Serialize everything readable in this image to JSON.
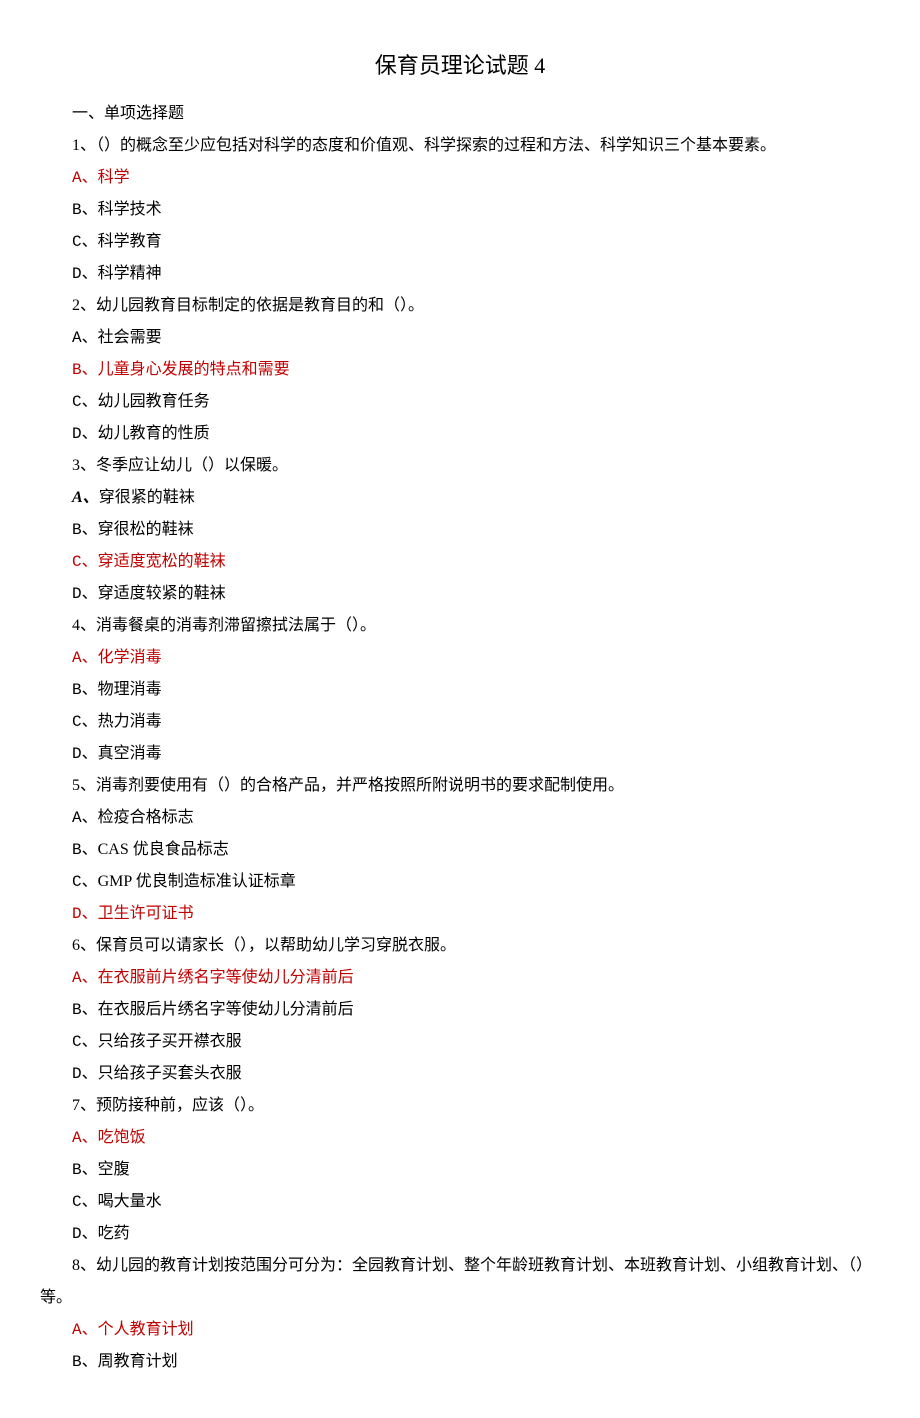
{
  "title": "保育员理论试题 4",
  "section_header": "一、单项选择题",
  "questions": [
    {
      "stem": "1、（）的概念至少应包括对科学的态度和价值观、科学探索的过程和方法、科学知识三个基本要素。",
      "options": [
        {
          "letter": "A、",
          "text": "科学",
          "correct": true
        },
        {
          "letter": "B、",
          "text": "科学技术",
          "correct": false
        },
        {
          "letter": "C、",
          "text": "科学教育",
          "correct": false
        },
        {
          "letter": "D、",
          "text": "科学精神",
          "correct": false
        }
      ]
    },
    {
      "stem": "2、幼儿园教育目标制定的依据是教育目的和（）。",
      "options": [
        {
          "letter": "A、",
          "text": "社会需要",
          "correct": false
        },
        {
          "letter": "B、",
          "text": "儿童身心发展的特点和需要",
          "correct": true
        },
        {
          "letter": "C、",
          "text": "幼儿园教育任务",
          "correct": false
        },
        {
          "letter": "D、",
          "text": "幼儿教育的性质",
          "correct": false
        }
      ]
    },
    {
      "stem": "3、冬季应让幼儿（）以保暖。",
      "options": [
        {
          "letter": "A、",
          "text": "穿很紧的鞋袜",
          "correct": false,
          "italicA": true
        },
        {
          "letter": "B、",
          "text": "穿很松的鞋袜",
          "correct": false
        },
        {
          "letter": "C、",
          "text": "穿适度宽松的鞋袜",
          "correct": true
        },
        {
          "letter": "D、",
          "text": "穿适度较紧的鞋袜",
          "correct": false
        }
      ]
    },
    {
      "stem": "4、消毒餐桌的消毒剂滞留擦拭法属于（）。",
      "options": [
        {
          "letter": "A、",
          "text": "化学消毒",
          "correct": true
        },
        {
          "letter": "B、",
          "text": "物理消毒",
          "correct": false
        },
        {
          "letter": "C、",
          "text": "热力消毒",
          "correct": false
        },
        {
          "letter": "D、",
          "text": "真空消毒",
          "correct": false
        }
      ]
    },
    {
      "stem": "5、消毒剂要使用有（）的合格产品，并严格按照所附说明书的要求配制使用。",
      "options": [
        {
          "letter": "A、",
          "text": "检疫合格标志",
          "correct": false
        },
        {
          "letter": "B、",
          "text": "CAS 优良食品标志",
          "correct": false
        },
        {
          "letter": "C、",
          "text": "GMP 优良制造标准认证标章",
          "correct": false
        },
        {
          "letter": "D、",
          "text": "卫生许可证书",
          "correct": true
        }
      ]
    },
    {
      "stem": "6、保育员可以请家长（），以帮助幼儿学习穿脱衣服。",
      "options": [
        {
          "letter": "A、",
          "text": "在衣服前片绣名字等使幼儿分清前后",
          "correct": true
        },
        {
          "letter": "B、",
          "text": "在衣服后片绣名字等使幼儿分清前后",
          "correct": false
        },
        {
          "letter": "C、",
          "text": "只给孩子买开襟衣服",
          "correct": false
        },
        {
          "letter": "D、",
          "text": "只给孩子买套头衣服",
          "correct": false
        }
      ]
    },
    {
      "stem": "7、预防接种前，应该（）。",
      "options": [
        {
          "letter": "A、",
          "text": "吃饱饭",
          "correct": true
        },
        {
          "letter": "B、",
          "text": "空腹",
          "correct": false
        },
        {
          "letter": "C、",
          "text": "喝大量水",
          "correct": false
        },
        {
          "letter": "D、",
          "text": "吃药",
          "correct": false
        }
      ]
    },
    {
      "stem": "8、幼儿园的教育计划按范围分可分为：全园教育计划、整个年龄班教育计划、本班教育计划、小组教育计划、（）等。",
      "wrap": true,
      "options": [
        {
          "letter": "A、",
          "text": "个人教育计划",
          "correct": true
        },
        {
          "letter": "B、",
          "text": "周教育计划",
          "correct": false
        }
      ]
    }
  ]
}
